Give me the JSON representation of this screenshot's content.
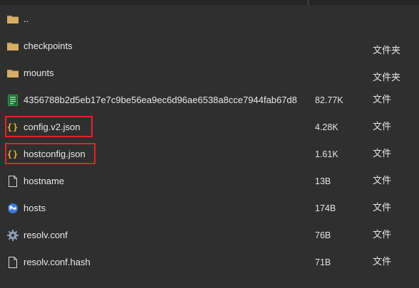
{
  "files": [
    {
      "name": "..",
      "size": "",
      "type": "",
      "icon": "folder-icon"
    },
    {
      "name": "checkpoints",
      "size": "",
      "type": "文件夹",
      "icon": "folder-icon"
    },
    {
      "name": "mounts",
      "size": "",
      "type": "文件夹",
      "icon": "folder-icon"
    },
    {
      "name": "4356788b2d5eb17e7c9be56ea9ec6d96ae6538a8cce7944fab67d8",
      "size": "82.77K",
      "type": "文件",
      "icon": "log-file-icon"
    },
    {
      "name": "config.v2.json",
      "size": "4.28K",
      "type": "文件",
      "icon": "json-icon",
      "highlighted": true
    },
    {
      "name": "hostconfig.json",
      "size": "1.61K",
      "type": "文件",
      "icon": "json-icon",
      "highlighted": true
    },
    {
      "name": "hostname",
      "size": "13B",
      "type": "文件",
      "icon": "file-icon"
    },
    {
      "name": "hosts",
      "size": "174B",
      "type": "文件",
      "icon": "globe-icon"
    },
    {
      "name": "resolv.conf",
      "size": "76B",
      "type": "文件",
      "icon": "gear-icon"
    },
    {
      "name": "resolv.conf.hash",
      "size": "71B",
      "type": "文件",
      "icon": "file-icon"
    }
  ],
  "colors": {
    "background": "#2f2f2f",
    "folder": "#c9a15a",
    "highlight": "#e0242a",
    "json_brace": "#e0b43a",
    "log_icon": "#2e9a4a",
    "globe": "#3a7bd5"
  }
}
